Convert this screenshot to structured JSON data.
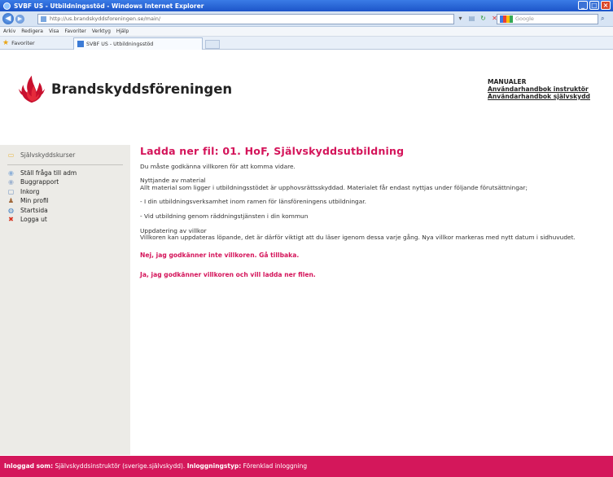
{
  "browser": {
    "title": "SVBF US - Utbildningsstöd - Windows Internet Explorer",
    "address": "http://us.brandskyddsforeningen.se/main/",
    "search_placeholder": "Google",
    "menu": [
      "Arkiv",
      "Redigera",
      "Visa",
      "Favoriter",
      "Verktyg",
      "Hjälp"
    ],
    "favorites_label": "Favoriter",
    "tab_label": "SVBF US - Utbildningsstöd"
  },
  "header": {
    "brand": "Brandskyddsföreningen",
    "manuals_heading": "MANUALER",
    "manual_links": [
      "Användarhandbok instruktör",
      "Användarhandbok självskydd"
    ]
  },
  "sidebar": {
    "items": [
      {
        "label": "Självskyddskurser",
        "icon": "folder-icon"
      },
      {
        "label": "Ställ fråga till adm",
        "icon": "question-icon"
      },
      {
        "label": "Buggrapport",
        "icon": "bug-icon"
      },
      {
        "label": "Inkorg",
        "icon": "inbox-icon"
      },
      {
        "label": "Min profil",
        "icon": "user-icon"
      },
      {
        "label": "Startsida",
        "icon": "globe-icon"
      },
      {
        "label": "Logga ut",
        "icon": "logout-icon"
      }
    ]
  },
  "main": {
    "title": "Ladda ner fil: 01. HoF, Självskyddsutbildning",
    "intro": "Du måste godkänna villkoren för att komma vidare.",
    "usage_heading": "Nyttjande av material",
    "usage_text": "Allt material som ligger i utbildningsstödet är upphovsrättsskyddad. Materialet får endast nyttjas under följande förutsättningar;",
    "condition_1": "- I din utbildningsverksamhet inom ramen för länsföreningens utbildningar.",
    "condition_2": "- Vid utbildning genom räddningstjänsten i din kommun",
    "update_heading": "Uppdatering av villkor",
    "update_text": "Villkoren kan uppdateras löpande, det är därför viktigt att du läser igenom dessa varje gång. Nya villkor markeras med nytt datum i sidhuvudet.",
    "deny_link": "Nej, jag godkänner inte villkoren. Gå tillbaka.",
    "accept_link": "Ja, jag godkänner villkoren och vill ladda ner filen."
  },
  "footer": {
    "logged_in_label": "Inloggad som:",
    "logged_in_value": "Självskyddsinstruktör (sverige.självskydd).",
    "login_type_label": "Inloggningstyp:",
    "login_type_value": "Förenklad inloggning"
  },
  "colors": {
    "accent": "#d4145a",
    "sidebar_bg": "#ecebe7",
    "footer_bg": "#d4175b"
  }
}
